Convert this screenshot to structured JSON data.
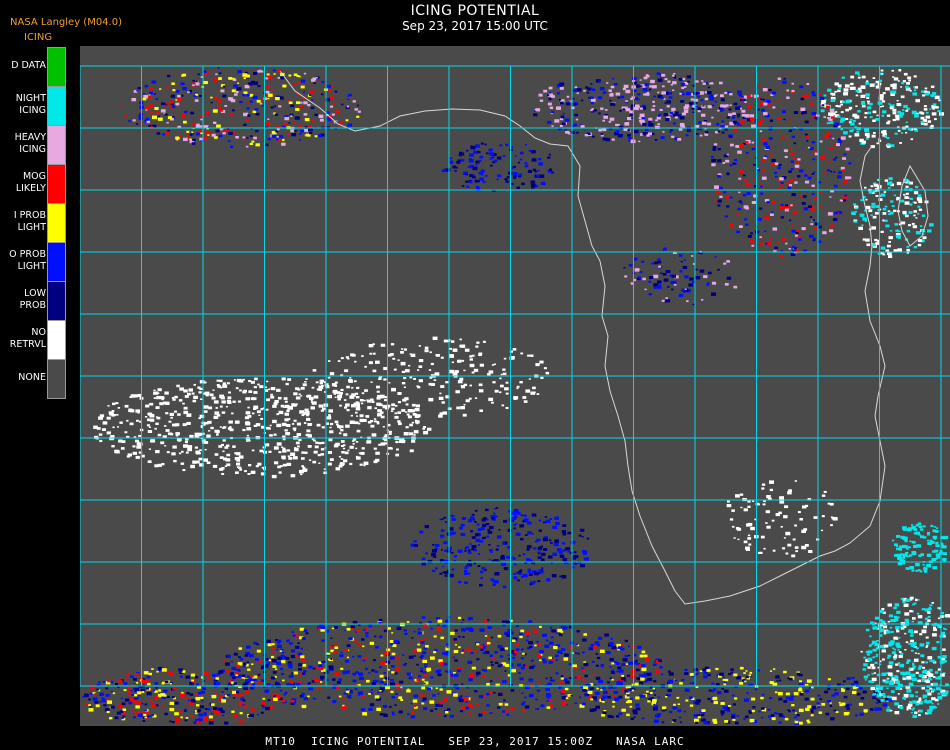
{
  "header": {
    "source": "NASA Langley (M04.0)",
    "legend_title": "ICING",
    "title": "ICING POTENTIAL",
    "datetime": "Sep 23, 2017 15:00 UTC"
  },
  "legend": [
    {
      "label": "D DATA",
      "color": "#00c000"
    },
    {
      "label": "NIGHT\nICING",
      "color": "#00e8e8"
    },
    {
      "label": "HEAVY\nICING",
      "color": "#e8a8e0"
    },
    {
      "label": "MOG\nLIKELY",
      "color": "#ff0000"
    },
    {
      "label": "I PROB\nLIGHT",
      "color": "#ffff00"
    },
    {
      "label": "O PROB\nLIGHT",
      "color": "#0010ff"
    },
    {
      "label": "LOW\nPROB",
      "color": "#000080"
    },
    {
      "label": "NO\nRETRVL",
      "color": "#ffffff"
    },
    {
      "label": "NONE",
      "color": "#4a4a4a"
    }
  ],
  "map": {
    "background": "#4a4a4a",
    "grid_color": "#00d8e8",
    "coast_color": "#d8d8d8",
    "label_color": "#c01818"
  },
  "footer": "MT10  ICING POTENTIAL   SEP 23, 2017 15:00Z   NASA LARC"
}
